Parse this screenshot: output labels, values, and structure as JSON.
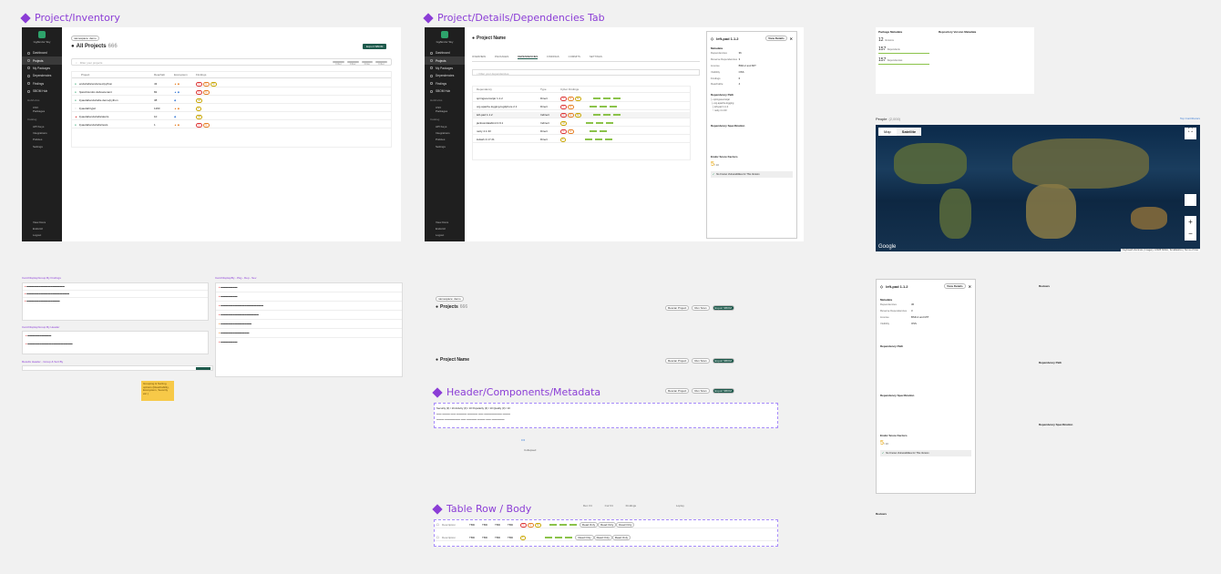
{
  "titles": {
    "inventory": "Project/Inventory",
    "details": "Project/Details/Dependencies Tab",
    "metadata": "Header/Components/Metadata",
    "tablerow": "Table Row / Body"
  },
  "inventory": {
    "org": "Gg/Endor Sky",
    "workspace": "namespace: demo",
    "heading": "All Projects",
    "count": "666",
    "export": "Export SBOM",
    "search_placeholder": "Filter your projects",
    "filters": [
      "Filter",
      "Filter",
      "Filter",
      "Filter"
    ],
    "cols": [
      "Project",
      "Reachab",
      "Ecosystem",
      "Findings"
    ],
    "rows": [
      [
        "endorlabs/endorsec/python",
        "43"
      ],
      [
        "hjacob/endor-defusetenant",
        "82"
      ],
      [
        "ilyaudal/endorlabs-demo/python",
        "38"
      ],
      [
        "ilyaudal/tryjwt",
        "1160"
      ],
      [
        "ilyaudal/endorlabs/alerts",
        "10"
      ],
      [
        "ilyaudal/endorlabs/tests",
        "1"
      ]
    ]
  },
  "sidebar": {
    "items": [
      "Dashboard",
      "Projects",
      "My Packages",
      "Dependencies",
      "Findings",
      "SBOM Hub"
    ],
    "head1": "Hub/Links",
    "sub1": [
      "CSV Packages"
    ],
    "head2": "Catalog",
    "sub2": [
      "API Keys",
      "Integrations",
      "Policies",
      "Settings"
    ],
    "bottom": [
      "View Docs",
      "EndorAI",
      "Logout"
    ]
  },
  "details": {
    "title": "Project Name",
    "tabs": [
      "OVERVIEW",
      "PACKAGES",
      "DEPENDENCIES",
      "FINDINGS",
      "COMMITS",
      "SETTINGS"
    ],
    "search": "Filter your dependencies",
    "cols": [
      "Dependency",
      "Type",
      "Cyber Findings"
    ],
    "deps": [
      [
        "springsource/jar 1.1.2",
        "Direct"
      ],
      [
        "org.apache.logging.log4j/core 2.1",
        "Direct"
      ],
      [
        "left-pad 1.1.2",
        "Indirect"
      ],
      [
        "jacksondatabind 2.9.1",
        "Indirect"
      ],
      [
        "netty 4.1.33",
        "Direct"
      ],
      [
        "lodash 4.17.21",
        "Direct"
      ]
    ],
    "panel_title": "left-pad 1.1.2",
    "view_details": "View Details",
    "meta_head": "Metadata",
    "meta": [
      [
        "Dependencies",
        "36"
      ],
      [
        "Reverse Dependencies",
        "3"
      ],
      [
        "License",
        "BSD-2 and MIT"
      ],
      [
        "Visibility",
        "OSS"
      ],
      [
        "Findings",
        "6"
      ],
      [
        "Reachable",
        "4"
      ]
    ],
    "dep_path": "Dependency Path",
    "spec": "Dependency Specification",
    "score": "Endor Score Factors",
    "score_val": "5",
    "score_max": "/ 10",
    "novuln": "No Known Vulnerabilities for This Version"
  },
  "package": {
    "left_title": "Package Metadata",
    "right_title": "Repository Version Metadata",
    "nums": [
      "12",
      "157",
      "157"
    ],
    "labels": [
      "Versions",
      "Dependents",
      "Dependencies"
    ]
  },
  "people": {
    "title": "People",
    "count": "(2,000)",
    "link": "Top Contributors",
    "tabs": [
      "Map",
      "Satellite"
    ],
    "google": "Google",
    "credit": "Keyboard shortcuts | Imagery ©2025 NASA, TerraMetrics | Terms of Use"
  },
  "groupby": {
    "t1": "Card Display/Group By Findings",
    "t2": "Card Display/Group By Header",
    "t3": "Results Header - Group & Sort By",
    "t4": "Card Display/By - Pkg - Dep - Sev",
    "comment": "Grouping & Sorting options (Reachability, Ecosystem, Severity etc.)"
  },
  "metadata": {
    "projects": "Projects",
    "count": "666",
    "name": "Project Name",
    "buttons": [
      "Rescan Project",
      "Run Scan",
      "Export SBOM"
    ],
    "line1": "Security (3) / 10   Activity (3) / 10   Popularity (3) / 10   Quality (3) / 10",
    "more": "•••",
    "label": "Collapsed"
  },
  "tablerow": {
    "cols": [
      "Ecosystem",
      "Ext. Ref.",
      "Det. Fit",
      "Cur Fit",
      "Findings",
      "Lopley"
    ],
    "cells": [
      "Description",
      "TBD",
      "TBD",
      "TBD",
      "TBD"
    ],
    "tags": [
      "Read Only",
      "Read Only",
      "Read Only"
    ]
  },
  "right": {
    "panel": "left-pad 1.1.2",
    "reviews": "Reviews",
    "dep_path": "Dependency Path",
    "spec": "Dependency Specification"
  }
}
